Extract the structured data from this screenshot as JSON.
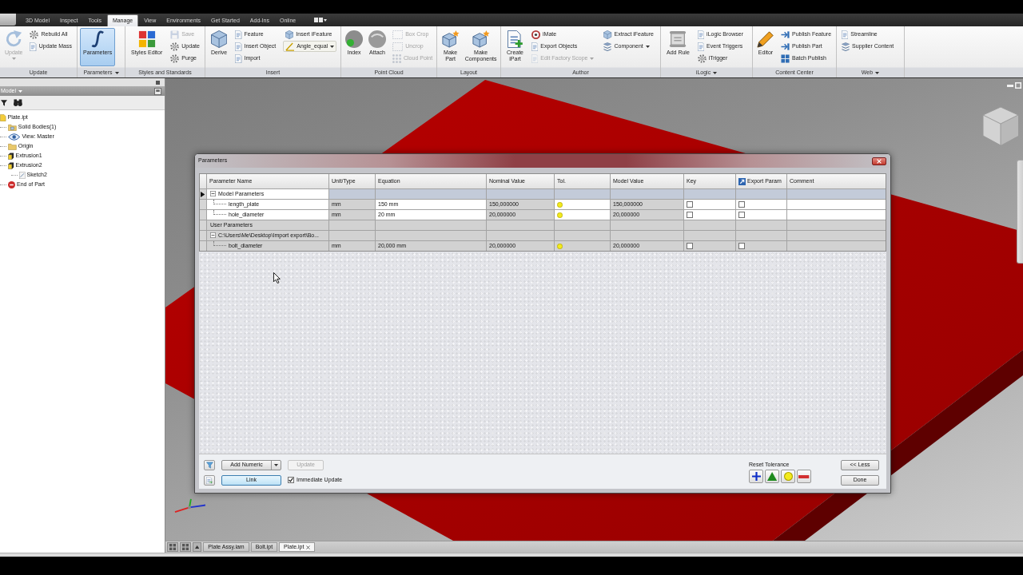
{
  "ribbon": {
    "tabs": [
      {
        "label": "3D Model",
        "selected": false
      },
      {
        "label": "Inspect",
        "selected": false
      },
      {
        "label": "Tools",
        "selected": false
      },
      {
        "label": "Manage",
        "selected": true
      },
      {
        "label": "View",
        "selected": false
      },
      {
        "label": "Environments",
        "selected": false
      },
      {
        "label": "Get Started",
        "selected": false
      },
      {
        "label": "Add-Ins",
        "selected": false
      },
      {
        "label": "Online",
        "selected": false
      }
    ],
    "panels": [
      {
        "label": "Update",
        "menu": false,
        "buttons": [
          {
            "label": "Update",
            "kind": "large",
            "disabled": true,
            "active": false,
            "menu": true
          },
          {
            "label": "Rebuild All",
            "kind": "small",
            "disabled": false,
            "active": false,
            "menu": false
          },
          {
            "label": "Update Mass",
            "kind": "small",
            "disabled": false,
            "active": false,
            "menu": false
          }
        ]
      },
      {
        "label": "Parameters",
        "menu": true,
        "buttons": [
          {
            "label": "Parameters",
            "kind": "large",
            "disabled": false,
            "active": true,
            "menu": false
          }
        ]
      },
      {
        "label": "Styles and Standards",
        "menu": false,
        "buttons": [
          {
            "label": "Styles Editor",
            "kind": "large",
            "disabled": false,
            "active": false,
            "menu": false
          },
          {
            "label": "Save",
            "kind": "small",
            "disabled": true,
            "active": false,
            "menu": false
          },
          {
            "label": "Update",
            "kind": "small",
            "disabled": false,
            "active": false,
            "menu": false
          },
          {
            "label": "Purge",
            "kind": "small",
            "disabled": false,
            "active": false,
            "menu": false
          }
        ]
      },
      {
        "label": "Insert",
        "menu": false,
        "buttons": [
          {
            "label": "Derive",
            "kind": "large",
            "disabled": false,
            "active": false,
            "menu": false
          },
          {
            "label": "Feature",
            "kind": "small",
            "disabled": false,
            "active": false,
            "menu": false
          },
          {
            "label": "Insert Object",
            "kind": "small",
            "disabled": false,
            "active": false,
            "menu": false
          },
          {
            "label": "Import",
            "kind": "small",
            "disabled": false,
            "active": false,
            "menu": false
          },
          {
            "label": "Insert iFeature",
            "kind": "small",
            "disabled": false,
            "active": false,
            "menu": false
          },
          {
            "label": "Angle_equal",
            "kind": "combo",
            "disabled": false,
            "active": false,
            "menu": true
          }
        ]
      },
      {
        "label": "Point Cloud",
        "menu": false,
        "buttons": [
          {
            "label": "Index",
            "kind": "large",
            "disabled": false,
            "active": false,
            "menu": false
          },
          {
            "label": "Attach",
            "kind": "large",
            "disabled": false,
            "active": false,
            "menu": false
          },
          {
            "label": "Box Crop",
            "kind": "small",
            "disabled": true,
            "active": false,
            "menu": false
          },
          {
            "label": "Uncrop",
            "kind": "small",
            "disabled": true,
            "active": false,
            "menu": false
          },
          {
            "label": "Cloud Point",
            "kind": "small",
            "disabled": true,
            "active": false,
            "menu": false
          }
        ]
      },
      {
        "label": "Layout",
        "menu": false,
        "buttons": [
          {
            "label": "Make\nPart",
            "kind": "large",
            "disabled": false,
            "active": false,
            "menu": false
          },
          {
            "label": "Make\nComponents",
            "kind": "large",
            "disabled": false,
            "active": false,
            "menu": false
          }
        ]
      },
      {
        "label": "Author",
        "menu": false,
        "buttons": [
          {
            "label": "Create\niPart",
            "kind": "large",
            "disabled": false,
            "active": false,
            "menu": false
          },
          {
            "label": "iMate",
            "kind": "small",
            "disabled": false,
            "active": false,
            "menu": false
          },
          {
            "label": "Export Objects",
            "kind": "small",
            "disabled": false,
            "active": false,
            "menu": false
          },
          {
            "label": "Edit Factory Scope",
            "kind": "small",
            "disabled": true,
            "active": false,
            "menu": true
          },
          {
            "label": "Extract iFeature",
            "kind": "small",
            "disabled": false,
            "active": false,
            "menu": false
          },
          {
            "label": "Component",
            "kind": "small",
            "disabled": false,
            "active": false,
            "menu": true
          }
        ]
      },
      {
        "label": "iLogic",
        "menu": true,
        "buttons": [
          {
            "label": "Add Rule",
            "kind": "large",
            "disabled": false,
            "active": false,
            "menu": false
          },
          {
            "label": "iLogic Browser",
            "kind": "small",
            "disabled": false,
            "active": false,
            "menu": false
          },
          {
            "label": "Event Triggers",
            "kind": "small",
            "disabled": false,
            "active": false,
            "menu": false
          },
          {
            "label": "iTrigger",
            "kind": "small",
            "disabled": false,
            "active": false,
            "menu": false
          }
        ]
      },
      {
        "label": "Content Center",
        "menu": false,
        "buttons": [
          {
            "label": "Editor",
            "kind": "large",
            "disabled": false,
            "active": false,
            "menu": false
          },
          {
            "label": "Publish Feature",
            "kind": "small",
            "disabled": false,
            "active": false,
            "menu": false
          },
          {
            "label": "Publish Part",
            "kind": "small",
            "disabled": false,
            "active": false,
            "menu": false
          },
          {
            "label": "Batch Publish",
            "kind": "small",
            "disabled": false,
            "active": false,
            "menu": false
          }
        ]
      },
      {
        "label": "Web",
        "menu": true,
        "buttons": [
          {
            "label": "Streamline",
            "kind": "small",
            "disabled": false,
            "active": false,
            "menu": false
          },
          {
            "label": "Supplier Content",
            "kind": "small",
            "disabled": false,
            "active": false,
            "menu": false
          }
        ]
      }
    ]
  },
  "model_browser": {
    "title": "Model",
    "tree": [
      {
        "label": "Plate.ipt",
        "kind": "part",
        "children": [
          {
            "label": "Solid Bodies(1)",
            "kind": "bodies"
          },
          {
            "label": "View: Master",
            "kind": "view"
          },
          {
            "label": "Origin",
            "kind": "folder"
          },
          {
            "label": "Extrusion1",
            "kind": "extrusion"
          },
          {
            "label": "Extrusion2",
            "kind": "extrusion",
            "children": [
              {
                "label": "Sketch2",
                "kind": "sketch"
              }
            ]
          },
          {
            "label": "End of Part",
            "kind": "end"
          }
        ]
      }
    ]
  },
  "parameters_dialog": {
    "title": "Parameters",
    "table": {
      "columns": [
        {
          "label": "Parameter Name",
          "kind": "text"
        },
        {
          "label": "Unit/Type",
          "kind": "text"
        },
        {
          "label": "Equation",
          "kind": "text"
        },
        {
          "label": "Nominal Value",
          "kind": "text"
        },
        {
          "label": "Tol.",
          "kind": "text"
        },
        {
          "label": "Model Value",
          "kind": "text"
        },
        {
          "label": "Key",
          "kind": "text"
        },
        {
          "label": "Export Param",
          "kind": "icon"
        },
        {
          "label": "Comment",
          "kind": "text"
        }
      ],
      "rows": [
        {
          "kind": "group",
          "name": "Model Parameters",
          "current": true,
          "expanded": true,
          "children": [
            {
              "kind": "parameter",
              "name": "length_plate",
              "unit": "mm",
              "equation": "150 mm",
              "nominal_value": "150,000000",
              "tolerance": {
                "kind": "nominal"
              },
              "model_value": "150,000000",
              "key": false,
              "export": false,
              "linked": false,
              "current": false
            },
            {
              "kind": "parameter",
              "name": "hole_diameter",
              "unit": "mm",
              "equation": "20 mm",
              "nominal_value": "20,000000",
              "tolerance": {
                "kind": "nominal"
              },
              "model_value": "20,000000",
              "key": false,
              "export": false,
              "linked": false,
              "current": false
            }
          ]
        },
        {
          "kind": "group",
          "name": "User Parameters",
          "current": false
        },
        {
          "kind": "group",
          "name": "C:\\Users\\Me\\Desktop\\Import export\\Bo...",
          "current": false,
          "expanded": true,
          "children": [
            {
              "kind": "parameter",
              "name": "bolt_diameter",
              "unit": "mm",
              "equation": "20,000 mm",
              "nominal_value": "20,000000",
              "tolerance": {
                "kind": "nominal"
              },
              "model_value": "20,000000",
              "key": false,
              "export": false,
              "linked": true,
              "current": false
            }
          ]
        }
      ]
    },
    "buttons": [
      {
        "label": "Add Numeric",
        "kind": "split",
        "disabled": false,
        "focused": false
      },
      {
        "label": "Update",
        "kind": "push",
        "disabled": true,
        "focused": false
      },
      {
        "label": "Link",
        "kind": "push",
        "disabled": false,
        "focused": true
      }
    ],
    "immediate_update": {
      "label": "Immediate Update",
      "checked": true
    },
    "reset_tolerance": {
      "label": "Reset Tolerance",
      "buttons": [
        {
          "kind": "upper"
        },
        {
          "kind": "median"
        },
        {
          "kind": "nominal"
        },
        {
          "kind": "lower"
        }
      ]
    },
    "side_buttons": [
      {
        "label": "<< Less"
      },
      {
        "label": "Done"
      }
    ]
  },
  "document_tabs": [
    {
      "label": "Plate Assy.iam",
      "selected": false
    },
    {
      "label": "Bolt.ipt",
      "selected": false
    },
    {
      "label": "Plate.ipt",
      "selected": true
    }
  ]
}
